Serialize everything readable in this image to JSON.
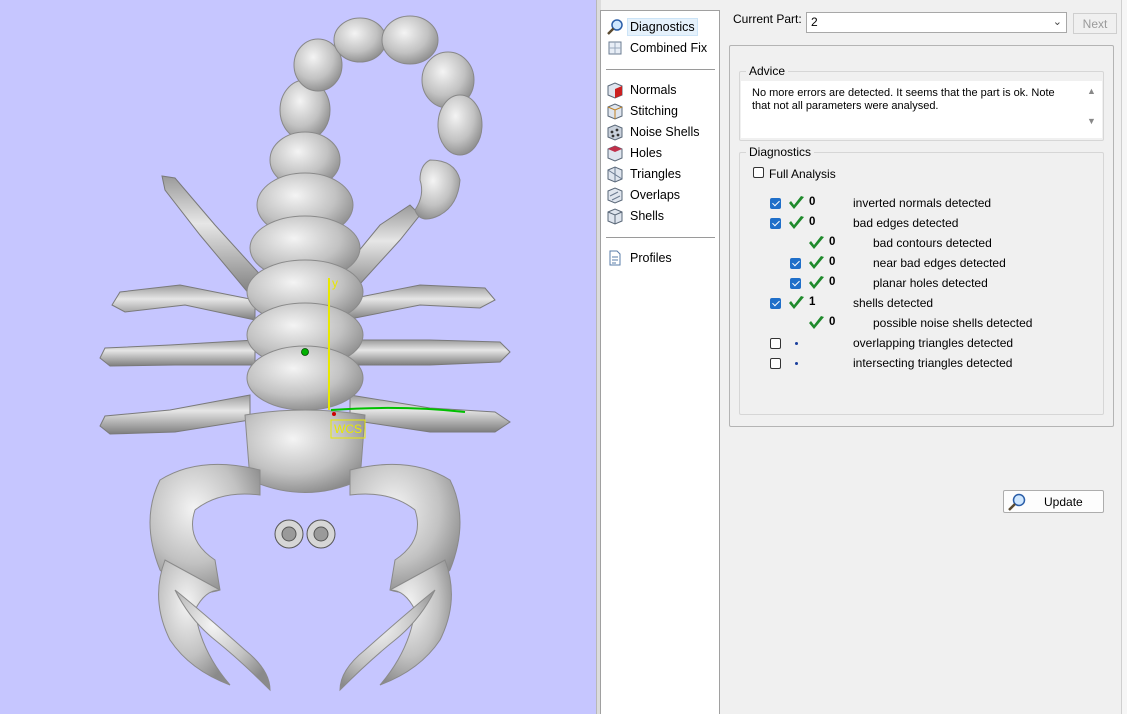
{
  "nav": {
    "items": [
      {
        "label": "Diagnostics",
        "icon": "magnifier-icon",
        "selected": true
      },
      {
        "label": "Combined Fix",
        "icon": "combined-fix-icon"
      },
      {
        "label": "Normals",
        "icon": "normals-cube-icon"
      },
      {
        "label": "Stitching",
        "icon": "stitching-cube-icon"
      },
      {
        "label": "Noise Shells",
        "icon": "noise-shells-cube-icon"
      },
      {
        "label": "Holes",
        "icon": "holes-cube-icon"
      },
      {
        "label": "Triangles",
        "icon": "triangles-cube-icon"
      },
      {
        "label": "Overlaps",
        "icon": "overlaps-cube-icon"
      },
      {
        "label": "Shells",
        "icon": "shells-cube-icon"
      },
      {
        "label": "Profiles",
        "icon": "profiles-document-icon"
      }
    ]
  },
  "header": {
    "current_part_label": "Current Part:",
    "current_part_value": "2",
    "next_label": "Next"
  },
  "advice": {
    "title": "Advice",
    "text": "No more errors are detected. It seems that the part is ok. Note that not all parameters were analysed."
  },
  "diagnostics": {
    "title": "Diagnostics",
    "full_analysis_label": "Full Analysis",
    "full_analysis_checked": false,
    "rows": [
      {
        "count": "0",
        "label": "inverted normals detected",
        "checkbox": true,
        "checked": true,
        "status": "ok",
        "indent": 0
      },
      {
        "count": "0",
        "label": "bad edges detected",
        "checkbox": true,
        "checked": true,
        "status": "ok",
        "indent": 0
      },
      {
        "count": "0",
        "label": "bad contours detected",
        "checkbox": false,
        "checked": false,
        "status": "ok",
        "indent": 1
      },
      {
        "count": "0",
        "label": "near bad edges detected",
        "checkbox": true,
        "checked": true,
        "status": "ok",
        "indent": 1
      },
      {
        "count": "0",
        "label": "planar holes detected",
        "checkbox": true,
        "checked": true,
        "status": "ok",
        "indent": 1
      },
      {
        "count": "1",
        "label": "shells detected",
        "checkbox": true,
        "checked": true,
        "status": "ok",
        "indent": 0
      },
      {
        "count": "0",
        "label": "possible noise shells detected",
        "checkbox": false,
        "checked": false,
        "status": "ok",
        "indent": 1
      },
      {
        "count": "",
        "label": "overlapping triangles detected",
        "checkbox": true,
        "checked": false,
        "status": "pending",
        "indent": 0
      },
      {
        "count": "",
        "label": "intersecting triangles detected",
        "checkbox": true,
        "checked": false,
        "status": "pending",
        "indent": 0
      }
    ],
    "update_label": "Update"
  },
  "viewport": {
    "axis_y_label": "y",
    "wcs_label": "WCS",
    "model_name": "scorpion-model",
    "colors": {
      "background": "#c6c6ff",
      "model": "#c4c4c4",
      "y_axis": "#e8e800",
      "x_axis": "#00c000"
    }
  }
}
